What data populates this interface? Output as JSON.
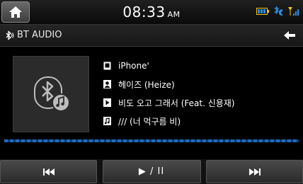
{
  "status": {
    "time": "08:33",
    "ampm": "AM"
  },
  "title": {
    "label": "BT AUDIO"
  },
  "track": {
    "device": "iPhone'",
    "artist": "헤이즈 (Heize)",
    "song": "비도 오고 그래서 (Feat. 신용재)",
    "album": "/// (너 먹구름 비)"
  },
  "controls": {
    "play_pause_label": "▶ / II"
  },
  "icons": {
    "home": "home-icon",
    "battery": "battery-icon",
    "bluetooth_phone": "bluetooth-phone-icon",
    "signal": "signal-icon",
    "back": "back-arrow-icon",
    "prev": "previous-track-icon",
    "next": "next-track-icon"
  },
  "colors": {
    "accent_blue": "#1f6cc0",
    "status_yellow": "#f0c419",
    "status_blue": "#2b8fe0"
  }
}
